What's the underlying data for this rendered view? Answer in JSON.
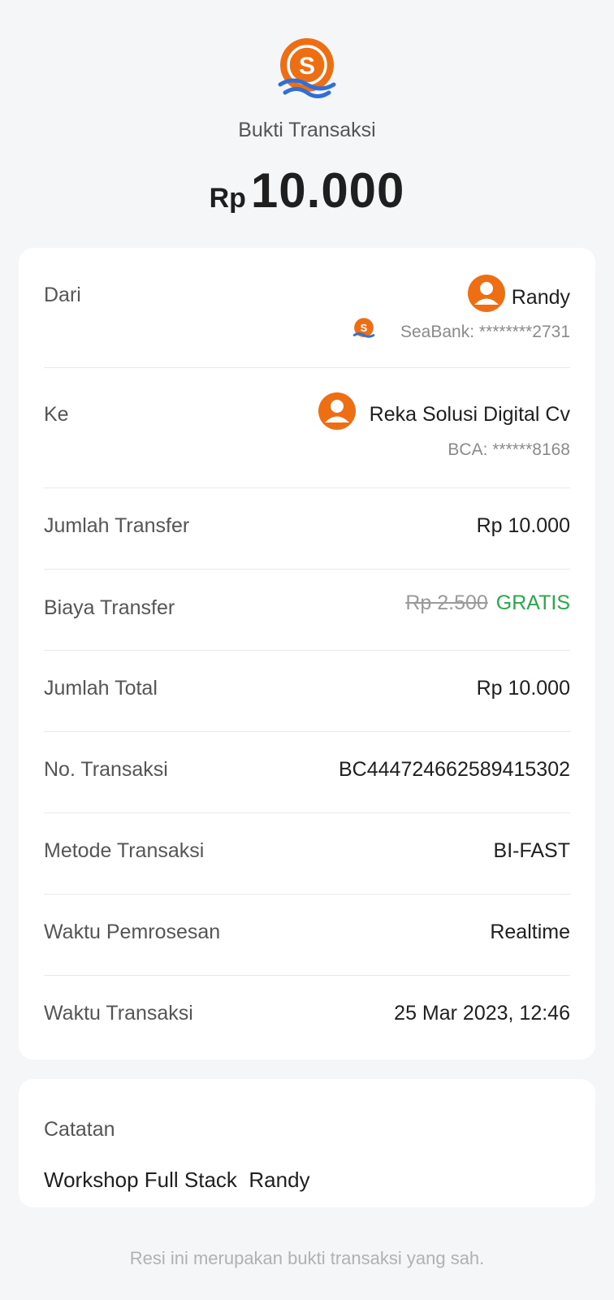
{
  "header": {
    "logo_icon": "seabank-logo-icon",
    "title": "Bukti Transaksi",
    "amount_currency": "Rp",
    "amount_value": "10.000"
  },
  "details": {
    "from": {
      "label": "Dari",
      "name": "Randy",
      "bank_icon": "seabank-logo-icon",
      "account": "SeaBank: ********2731"
    },
    "to": {
      "label": "Ke",
      "name": "Reka Solusi Digital Cv",
      "account": "BCA: ******8168"
    },
    "transfer_amount": {
      "label": "Jumlah Transfer",
      "value": "Rp 10.000"
    },
    "transfer_fee": {
      "label": "Biaya Transfer",
      "original": "Rp 2.500",
      "value": "GRATIS"
    },
    "total": {
      "label": "Jumlah Total",
      "value": "Rp 10.000"
    },
    "transaction_no": {
      "label": "No. Transaksi",
      "value": "BC444724662589415302"
    },
    "method": {
      "label": "Metode Transaksi",
      "value": "BI-FAST"
    },
    "processing_time": {
      "label": "Waktu Pemrosesan",
      "value": "Realtime"
    },
    "transaction_time": {
      "label": "Waktu Transaksi",
      "value": "25 Mar 2023, 12:46"
    }
  },
  "note": {
    "label": "Catatan",
    "text": "Workshop Full Stack  Randy"
  },
  "footer": {
    "text": "Resi ini merupakan bukti transaksi yang sah."
  },
  "colors": {
    "brand_orange": "#ee6e14",
    "brand_blue": "#2f6fd6",
    "free_green": "#2aa84a",
    "background": "#f5f6f8"
  }
}
